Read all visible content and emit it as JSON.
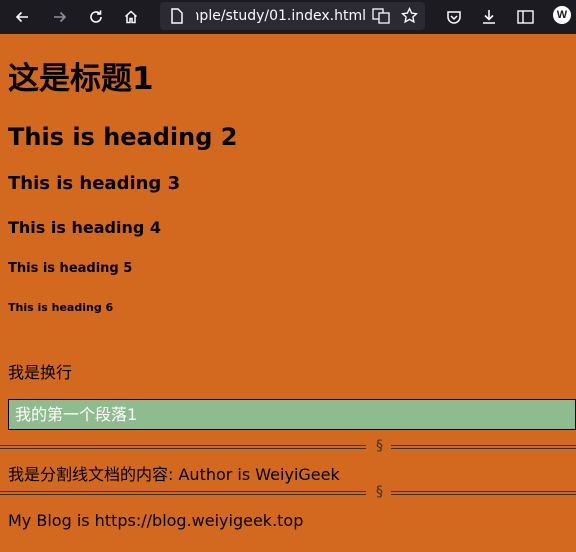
{
  "browser": {
    "url": "mple/study/01.index.html",
    "profile_initial": "W"
  },
  "page": {
    "h1": "这是标题1",
    "h2": "This is heading 2",
    "h3": "This is heading 3",
    "h4": "This is heading 4",
    "h5": "This is heading 5",
    "h6": "This is heading 6",
    "line_break_text": "我是换行",
    "first_paragraph": "我的第一个段落1",
    "divider_mark": "§",
    "author_text": "我是分割线文档的内容: Author is WeiyiGeek",
    "blog_text": "My Blog is https://blog.weiyigeek.top"
  },
  "colors": {
    "page_background": "#d2691e",
    "paragraph_background": "#8fbc8f",
    "toolbar_background": "#1c1b22"
  }
}
